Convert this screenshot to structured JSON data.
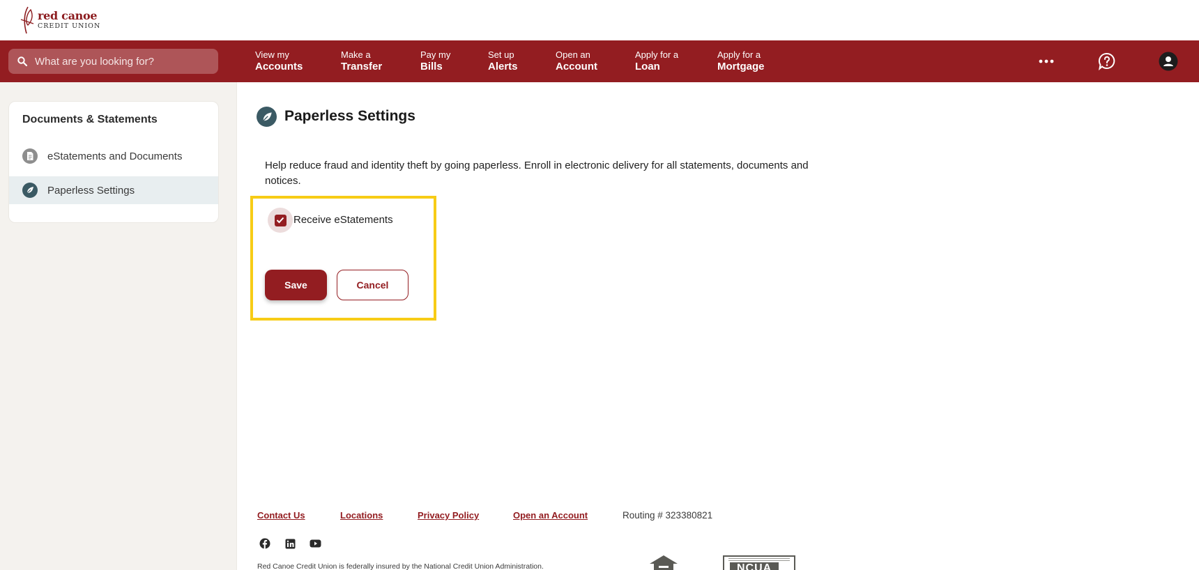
{
  "brand": {
    "name": "red canoe",
    "subtitle": "CREDIT UNION",
    "primary_color": "#931d21"
  },
  "search": {
    "placeholder": "What are you looking for?"
  },
  "nav": {
    "items": [
      {
        "small": "View my",
        "big": "Accounts"
      },
      {
        "small": "Make a",
        "big": "Transfer"
      },
      {
        "small": "Pay my",
        "big": "Bills"
      },
      {
        "small": "Set up",
        "big": "Alerts"
      },
      {
        "small": "Open an",
        "big": "Account"
      },
      {
        "small": "Apply for a",
        "big": "Loan"
      },
      {
        "small": "Apply for a",
        "big": "Mortgage"
      }
    ],
    "icons": [
      "more-icon",
      "help-chat-icon",
      "profile-icon"
    ]
  },
  "sidebar": {
    "title": "Documents & Statements",
    "items": [
      {
        "label": "eStatements and Documents",
        "icon": "document-icon",
        "active": false
      },
      {
        "label": "Paperless Settings",
        "icon": "leaf-icon",
        "active": true
      }
    ]
  },
  "main": {
    "title": "Paperless Settings",
    "description": "Help reduce fraud and identity theft by going paperless. Enroll in electronic delivery for all statements, documents and notices.",
    "checkbox": {
      "label": "Receive eStatements",
      "checked": true
    },
    "save_label": "Save",
    "cancel_label": "Cancel",
    "highlight_color": "#f7cc16"
  },
  "footer": {
    "links": [
      "Contact Us",
      "Locations",
      "Privacy Policy",
      "Open an Account"
    ],
    "routing": "Routing # 323380821",
    "social": [
      "facebook-icon",
      "linkedin-icon",
      "youtube-icon"
    ],
    "disclaimer": "Red Canoe Credit Union is federally insured by the National Credit Union Administration.",
    "ncua_label": "NCUA"
  }
}
